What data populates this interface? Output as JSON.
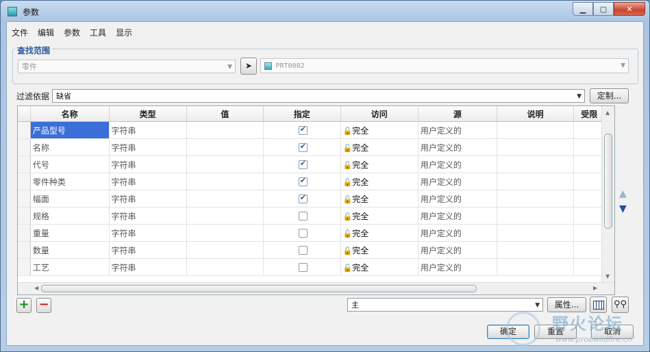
{
  "window": {
    "title": "参数",
    "controls": {
      "minimize": "▁",
      "maximize": "▢",
      "close": "✕"
    }
  },
  "menu": [
    "文件",
    "编辑",
    "参数",
    "工具",
    "显示"
  ],
  "scope": {
    "title": "查找范围",
    "type_value": "零件",
    "object_value": "PRT0002"
  },
  "filter": {
    "label": "过滤依据",
    "value": "缺省",
    "customize_label": "定制..."
  },
  "table": {
    "columns": [
      "名称",
      "类型",
      "值",
      "指定",
      "访问",
      "源",
      "说明",
      "受限"
    ],
    "rows": [
      {
        "name": "产品型号",
        "type": "字符串",
        "value": "",
        "designated": true,
        "access": "完全",
        "source": "用户定义的",
        "selected": true
      },
      {
        "name": "名称",
        "type": "字符串",
        "value": "",
        "designated": true,
        "access": "完全",
        "source": "用户定义的",
        "selected": false
      },
      {
        "name": "代号",
        "type": "字符串",
        "value": "",
        "designated": true,
        "access": "完全",
        "source": "用户定义的",
        "selected": false
      },
      {
        "name": "零件种类",
        "type": "字符串",
        "value": "",
        "designated": true,
        "access": "完全",
        "source": "用户定义的",
        "selected": false
      },
      {
        "name": "幅面",
        "type": "字符串",
        "value": "",
        "designated": true,
        "access": "完全",
        "source": "用户定义的",
        "selected": false
      },
      {
        "name": "规格",
        "type": "字符串",
        "value": "",
        "designated": false,
        "access": "完全",
        "source": "用户定义的",
        "selected": false
      },
      {
        "name": "重量",
        "type": "字符串",
        "value": "",
        "designated": false,
        "access": "完全",
        "source": "用户定义的",
        "selected": false
      },
      {
        "name": "数量",
        "type": "字符串",
        "value": "",
        "designated": false,
        "access": "完全",
        "source": "用户定义的",
        "selected": false
      },
      {
        "name": "工艺",
        "type": "字符串",
        "value": "",
        "designated": false,
        "access": "完全",
        "source": "用户定义的",
        "selected": false
      }
    ]
  },
  "bottom": {
    "add": "+",
    "remove": "−",
    "main_value": "主",
    "properties_label": "属性..."
  },
  "actions": {
    "ok": "确定",
    "reset": "重置",
    "cancel": "取消"
  },
  "watermark": {
    "text": "野火论坛",
    "url": "www.proewildfire.cn"
  },
  "colors": {
    "selection": "#3a6fd8",
    "group_title": "#2a5a9a",
    "add": "#1a8a1a",
    "remove": "#c02020"
  }
}
